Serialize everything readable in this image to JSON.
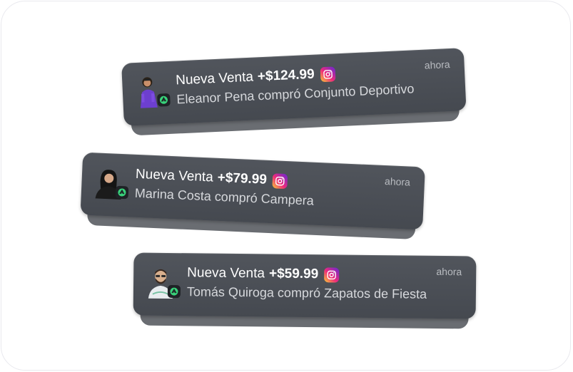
{
  "notifications": [
    {
      "title": "Nueva Venta",
      "amount": "+$124.99",
      "description": "Eleanor Pena compró Conjunto Deportivo",
      "time": "ahora",
      "avatar_icon": "person-purple-outfit-icon",
      "source_icon": "instagram-icon"
    },
    {
      "title": "Nueva Venta",
      "amount": "+$79.99",
      "description": "Marina Costa compró Campera",
      "time": "ahora",
      "avatar_icon": "person-dark-outfit-icon",
      "source_icon": "instagram-icon"
    },
    {
      "title": "Nueva Venta",
      "amount": "+$59.99",
      "description": "Tomás Quiroga compró Zapatos de Fiesta",
      "time": "ahora",
      "avatar_icon": "person-bearded-icon",
      "source_icon": "instagram-icon"
    }
  ],
  "colors": {
    "card": "#4b4f56",
    "instagram_start": "#f9ce34",
    "instagram_mid": "#ee2a7b",
    "instagram_end": "#6228d7",
    "badge_green": "#38d27a"
  }
}
